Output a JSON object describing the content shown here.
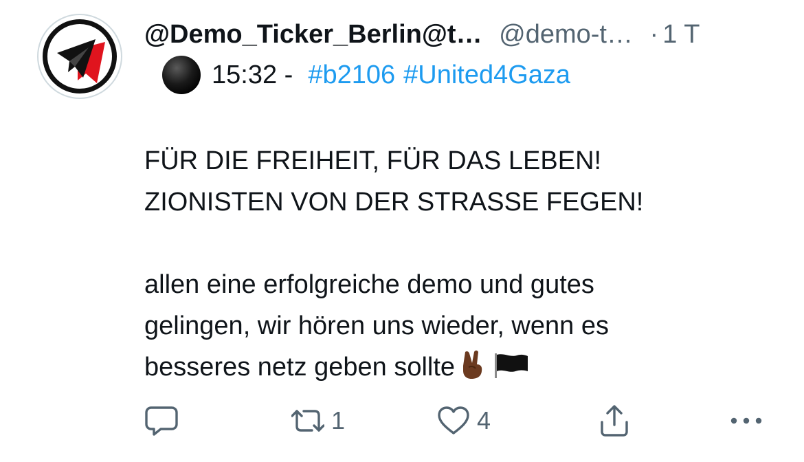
{
  "tweet": {
    "display_name": "@Demo_Ticker_Berlin@t…",
    "handle": "@demo-t…",
    "separator": "·",
    "time_ago": "1 T",
    "time_prefix": "15:32 -",
    "hashtags": [
      "#b2106",
      "#United4Gaza"
    ],
    "body_lines": [
      "FÜR DIE FREIHEIT, FÜR DAS LEBEN!",
      "ZIONISTEN VON DER STRASSE FEGEN!",
      "",
      "allen eine erfolgreiche demo und gutes",
      "gelingen, wir hören uns wieder, wenn es",
      "besseres netz geben sollte"
    ],
    "icons": {
      "avatar": "telegram-plane-logo",
      "status_emoji": "black-circle-emoji",
      "peace_emoji": "victory-hand-emoji",
      "flag_emoji": "black-flag-emoji"
    }
  },
  "actions": {
    "reply_icon": "reply-icon",
    "retweet_icon": "retweet-icon",
    "retweet_count": "1",
    "like_icon": "heart-icon",
    "like_count": "4",
    "share_icon": "share-icon",
    "more_icon": "more-icon"
  },
  "colors": {
    "text": "#0f1419",
    "secondary": "#536471",
    "link": "#1d9bf0",
    "avatar_red": "#e0141e"
  }
}
